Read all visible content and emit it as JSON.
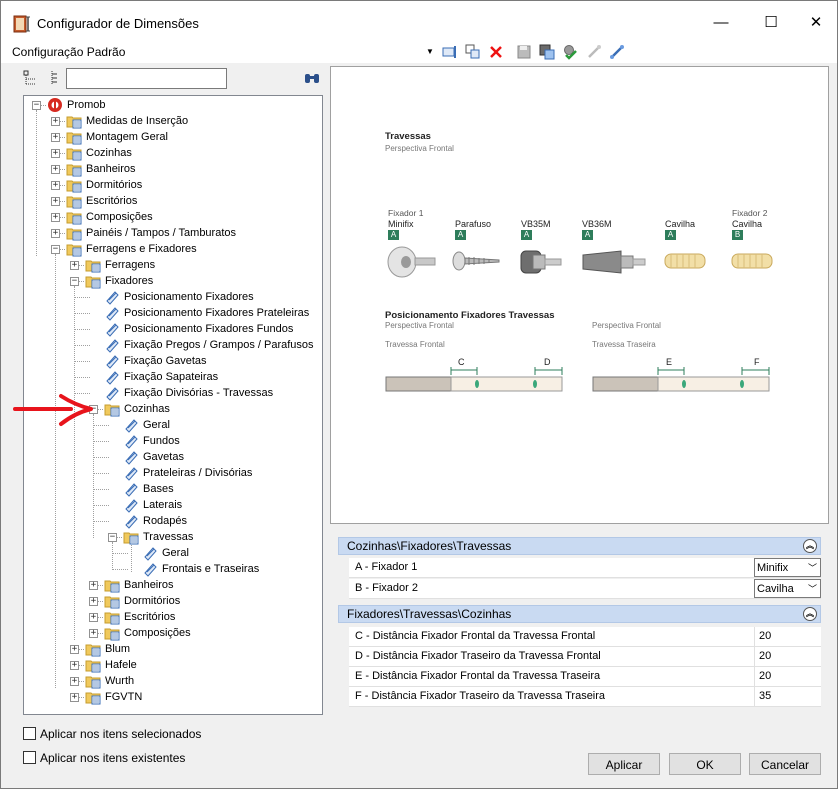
{
  "window": {
    "title": "Configurador de Dimensões",
    "minimize": "—",
    "maximize": "☐",
    "close": "✕"
  },
  "config": {
    "label": "Configuração Padrão"
  },
  "search": {
    "value": "",
    "placeholder": ""
  },
  "tree": {
    "root": "Promob",
    "n1": "Medidas de Inserção",
    "n2": "Montagem Geral",
    "n3": "Cozinhas",
    "n4": "Banheiros",
    "n5": "Dormitórios",
    "n6": "Escritórios",
    "n7": "Composições",
    "n8": "Painéis / Tampos / Tamburatos",
    "n9": "Ferragens e Fixadores",
    "n10": "Ferragens",
    "n11": "Fixadores",
    "f1": "Posicionamento Fixadores",
    "f2": "Posicionamento Fixadores Prateleiras",
    "f3": "Posicionamento Fixadores Fundos",
    "f4": "Fixação Pregos / Grampos / Parafusos",
    "f5": "Fixação Gavetas",
    "f6": "Fixação Sapateiras",
    "f7": "Fixação Divisórias - Travessas",
    "c0": "Cozinhas",
    "c1": "Geral",
    "c2": "Fundos",
    "c3": "Gavetas",
    "c4": "Prateleiras / Divisórias",
    "c5": "Bases",
    "c6": "Laterais",
    "c7": "Rodapés",
    "c8": "Travessas",
    "t1": "Geral",
    "t2": "Frontais e Traseiras",
    "d1": "Banheiros",
    "d2": "Dormitórios",
    "d3": "Escritórios",
    "d4": "Composições",
    "e1": "Blum",
    "e2": "Hafele",
    "e3": "Wurth",
    "e4": "FGVTN"
  },
  "preview": {
    "title1": "Travessas",
    "sub1": "Perspectiva Frontal",
    "fx1_top": "Fixador 1",
    "fx1": "Minifix",
    "fx1_badge": "A",
    "fx2": "Parafuso",
    "fx2_badge": "A",
    "fx3": "VB35M",
    "fx3_badge": "A",
    "fx4": "VB36M",
    "fx4_badge": "A",
    "fx5": "Cavilha",
    "fx5_badge": "A",
    "fx6_top": "Fixador 2",
    "fx6": "Cavilha",
    "fx6_badge": "B",
    "title2": "Posicionamento Fixadores Travessas",
    "sub2": "Perspectiva Frontal",
    "sub3": "Perspectiva Frontal",
    "trav_frontal": "Travessa Frontal",
    "trav_traseira": "Travessa Traseira",
    "dim_c": "C",
    "dim_d": "D",
    "dim_e": "E",
    "dim_f": "F"
  },
  "group1": {
    "header": "Cozinhas\\Fixadores\\Travessas",
    "rows": [
      {
        "name": "A - Fixador 1",
        "value": "Minifix"
      },
      {
        "name": "B - Fixador 2",
        "value": "Cavilha"
      }
    ]
  },
  "group2": {
    "header": "Fixadores\\Travessas\\Cozinhas",
    "rows": [
      {
        "name": "C - Distância Fixador Frontal da Travessa Frontal",
        "value": "20"
      },
      {
        "name": "D - Distância Fixador Traseiro da Travessa Frontal",
        "value": "20"
      },
      {
        "name": "E - Distância Fixador Frontal da Travessa Traseira",
        "value": "20"
      },
      {
        "name": "F - Distância Fixador Traseiro da Travessa Traseira",
        "value": "35"
      }
    ]
  },
  "options": {
    "apply_selected": "Aplicar nos itens selecionados",
    "apply_existing": "Aplicar nos itens existentes"
  },
  "buttons": {
    "apply": "Aplicar",
    "ok": "OK",
    "cancel": "Cancelar"
  },
  "colors": {
    "accent_header": "#c9daf2",
    "badge": "#2e7d5b",
    "arrow": "#e8141c"
  }
}
